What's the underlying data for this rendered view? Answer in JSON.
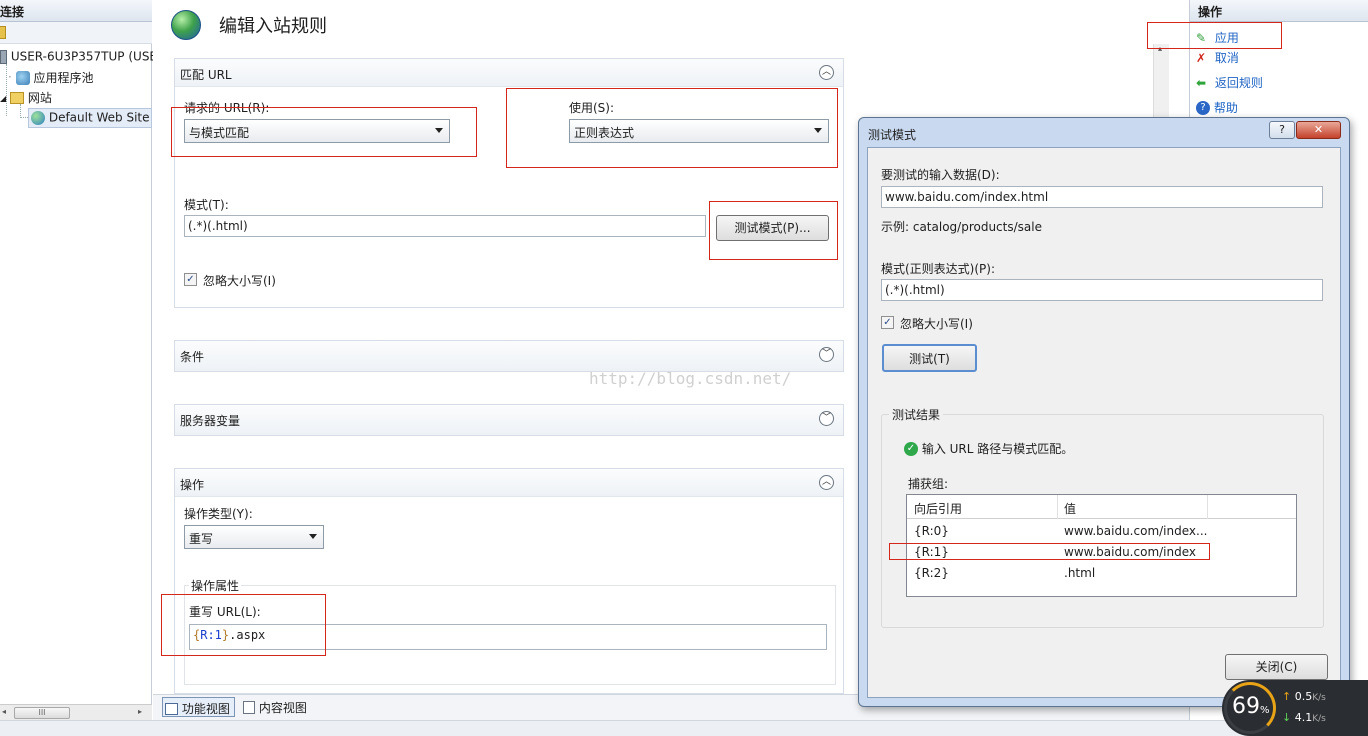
{
  "left_panel": {
    "header": "连接",
    "tree": [
      {
        "label": "USER-6U3P357TUP (USE",
        "icon": "server-icon"
      },
      {
        "label": "应用程序池",
        "icon": "app-pool-icon"
      },
      {
        "label": "网站",
        "icon": "sites-folder-icon"
      },
      {
        "label": "Default Web Site",
        "icon": "globe-icon"
      }
    ],
    "scroll_grip": "III"
  },
  "main": {
    "title": "编辑入站规则",
    "match_url": {
      "header": "匹配 URL",
      "requested_url_label": "请求的 URL(R):",
      "requested_url_value": "与模式匹配",
      "using_label": "使用(S):",
      "using_value": "正则表达式",
      "pattern_label": "模式(T):",
      "pattern_value": "(.*)(.html)",
      "test_pattern_button": "测试模式(P)...",
      "ignore_case_label": "忽略大小写(I)"
    },
    "conditions_header": "条件",
    "server_variables_header": "服务器变量",
    "watermark": "http://blog.csdn.net/",
    "action": {
      "header": "操作",
      "type_label": "操作类型(Y):",
      "type_value": "重写",
      "properties_label": "操作属性",
      "rewrite_url_label": "重写 URL(L):",
      "rewrite_url_value_brace_open": "{",
      "rewrite_url_value_var": "R:1",
      "rewrite_url_value_brace_close": "}",
      "rewrite_url_value_suffix": ".aspx"
    },
    "bottom_tabs": {
      "features_view": "功能视图",
      "content_view": "内容视图"
    }
  },
  "right_panel": {
    "header": "操作",
    "actions": [
      {
        "label": "应用",
        "icon": "apply-icon"
      },
      {
        "label": "取消",
        "icon": "cancel-icon"
      },
      {
        "label": "返回规则",
        "icon": "back-arrow-icon"
      },
      {
        "label": "帮助",
        "icon": "help-icon"
      }
    ]
  },
  "dialog": {
    "title": "测试模式",
    "help_button": "?",
    "close_button": "✕",
    "input_label": "要测试的输入数据(D):",
    "input_value": "www.baidu.com/index.html",
    "example_text": "示例: catalog/products/sale",
    "pattern_label": "模式(正则表达式)(P):",
    "pattern_value": "(.*)(.html)",
    "ignore_case_label": "忽略大小写(I)",
    "test_button": "测试(T)",
    "results_label": "测试结果",
    "result_message": "输入 URL 路径与模式匹配。",
    "capture_groups_label": "捕获组:",
    "grid_headers": [
      "向后引用",
      "值"
    ],
    "grid_rows": [
      {
        "ref": "{R:0}",
        "value": "www.baidu.com/index..."
      },
      {
        "ref": "{R:1}",
        "value": "www.baidu.com/index"
      },
      {
        "ref": "{R:2}",
        "value": ".html"
      }
    ],
    "close_dialog_button": "关闭(C)"
  },
  "net_monitor": {
    "percent": "69",
    "percent_sign": "%",
    "upload": "0.5",
    "download": "4.1",
    "unit": "K/s"
  },
  "colors": {
    "highlight_red": "#d4261b",
    "link_blue": "#1f64c5",
    "ok_green": "#2ea84a"
  }
}
